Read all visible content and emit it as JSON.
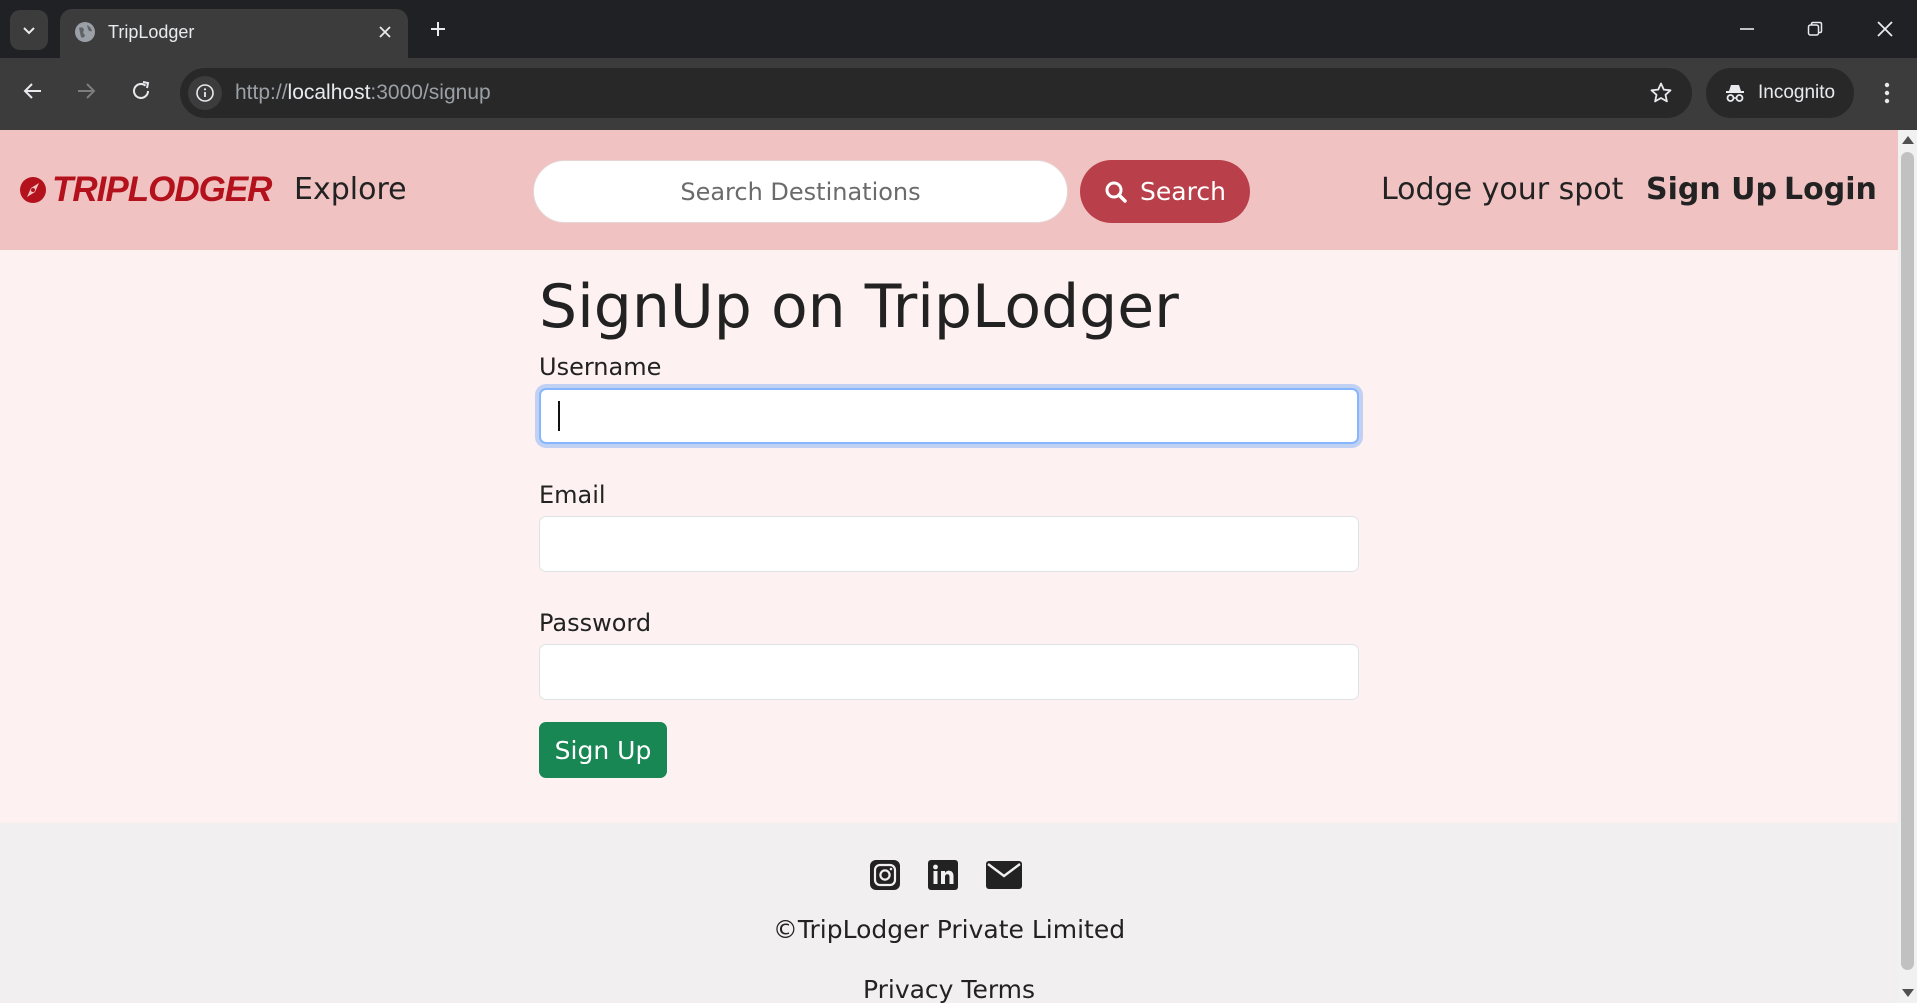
{
  "browser": {
    "tab_title": "TripLodger",
    "url_prefix": "http://",
    "url_host": "localhost",
    "url_rest": ":3000/signup",
    "incognito_label": "Incognito"
  },
  "navbar": {
    "brand": "TRIPLODGER",
    "explore": "Explore",
    "search_placeholder": "Search Destinations",
    "search_button": "Search",
    "lodge_link": "Lodge your spot",
    "signup_link": "Sign Up",
    "login_link": "Login"
  },
  "form": {
    "heading": "SignUp on TripLodger",
    "username_label": "Username",
    "username_value": "",
    "email_label": "Email",
    "email_value": "",
    "password_label": "Password",
    "password_value": "",
    "submit_label": "Sign Up"
  },
  "footer": {
    "copyright": "©TripLodger Private Limited",
    "links": "Privacy  Terms"
  },
  "icons": {
    "favicon": "globe-icon",
    "socials": [
      "instagram-icon",
      "linkedin-icon",
      "envelope-icon"
    ]
  },
  "colors": {
    "navbar_bg": "#f0c2c2",
    "page_bg": "#fdf2f1",
    "brand": "#b3111b",
    "search_button": "#b9404a",
    "submit_button": "#198754",
    "footer_bg": "#f1eff0"
  }
}
